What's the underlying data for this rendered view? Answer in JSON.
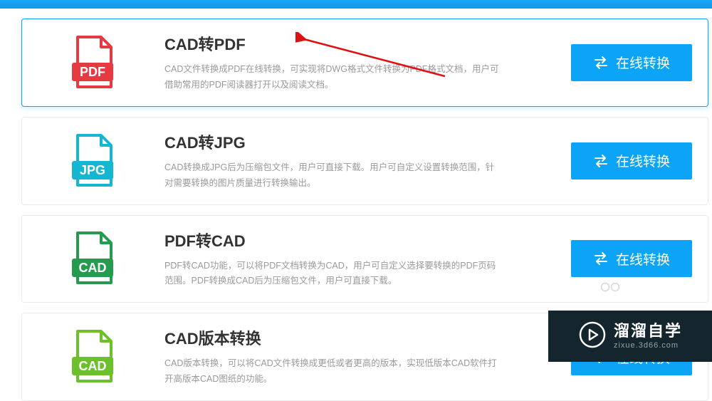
{
  "items": [
    {
      "icon": "pdf",
      "color": "#e63a43",
      "title": "CAD转PDF",
      "desc": "CAD文件转换成PDF在线转换，可实现将DWG格式文件转换为PDF格式文档，用户可借助常用的PDF阅读器打开以及阅读文档。",
      "button": "在线转换",
      "active": true
    },
    {
      "icon": "jpg",
      "color": "#14b7cf",
      "title": "CAD转JPG",
      "desc": "CAD转换成JPG后为压缩包文件，用户可直接下载。用户可自定义设置转换范围，针对需要转换的图片质量进行转换输出。",
      "button": "在线转换",
      "active": false
    },
    {
      "icon": "cad",
      "color": "#249b4f",
      "title": "PDF转CAD",
      "desc": "PDF转CAD功能，可以将PDF文档转换为CAD，用户可自定义选择要转换的PDF页码范围。PDF转换成CAD后为压缩包文件，用户可直接下载。",
      "button": "在线转换",
      "active": false
    },
    {
      "icon": "cad",
      "color": "#6cc029",
      "title": "CAD版本转换",
      "desc": "CAD版本转换，可以将CAD文件转换成更低或者更高的版本，实现低版本CAD软件打开高版本CAD图纸的功能。",
      "button": "在线转换",
      "active": false
    }
  ],
  "brand": {
    "cn": "溜溜自学",
    "en": "zixue.3d66.com"
  }
}
